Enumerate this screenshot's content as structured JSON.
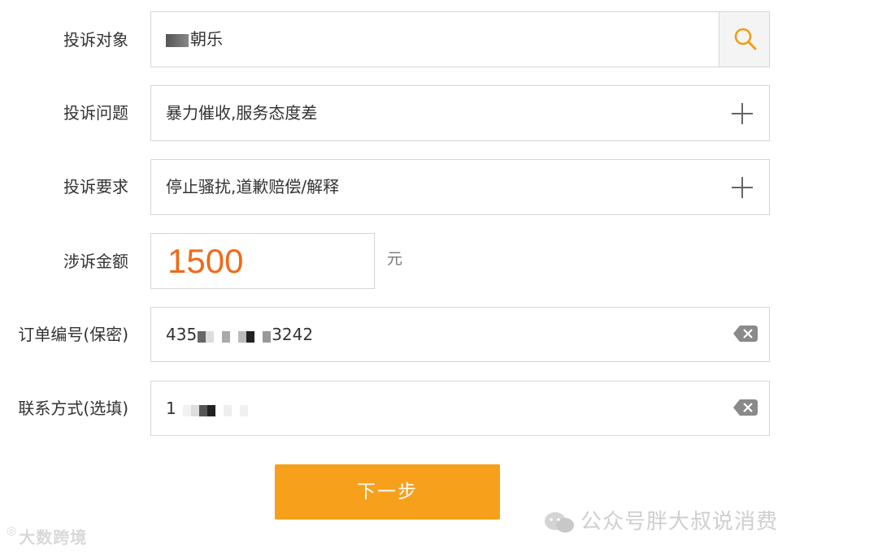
{
  "fields": [
    {
      "label": "投诉对象",
      "value": "朝乐",
      "action_icon": "search-icon"
    },
    {
      "label": "投诉问题",
      "value": "暴力催收,服务态度差",
      "action_icon": "plus-icon"
    },
    {
      "label": "投诉要求",
      "value": "停止骚扰,道歉赔偿/解释",
      "action_icon": "plus-icon"
    },
    {
      "label": "涉诉金额",
      "value": "1500",
      "unit": "元"
    },
    {
      "label": "订单编号(保密)",
      "value_prefix": "435",
      "value_suffix": "3242",
      "action_icon": "clear-icon"
    },
    {
      "label": "联系方式(选填)",
      "value_prefix": "1",
      "action_icon": "clear-icon"
    }
  ],
  "next_button": "下一步",
  "watermark_left": "大数跨境",
  "watermark_right": "公众号胖大叔说消费",
  "colors": {
    "accent": "#f6a01b",
    "amount": "#f06a1a",
    "border": "#d6d6d6"
  }
}
